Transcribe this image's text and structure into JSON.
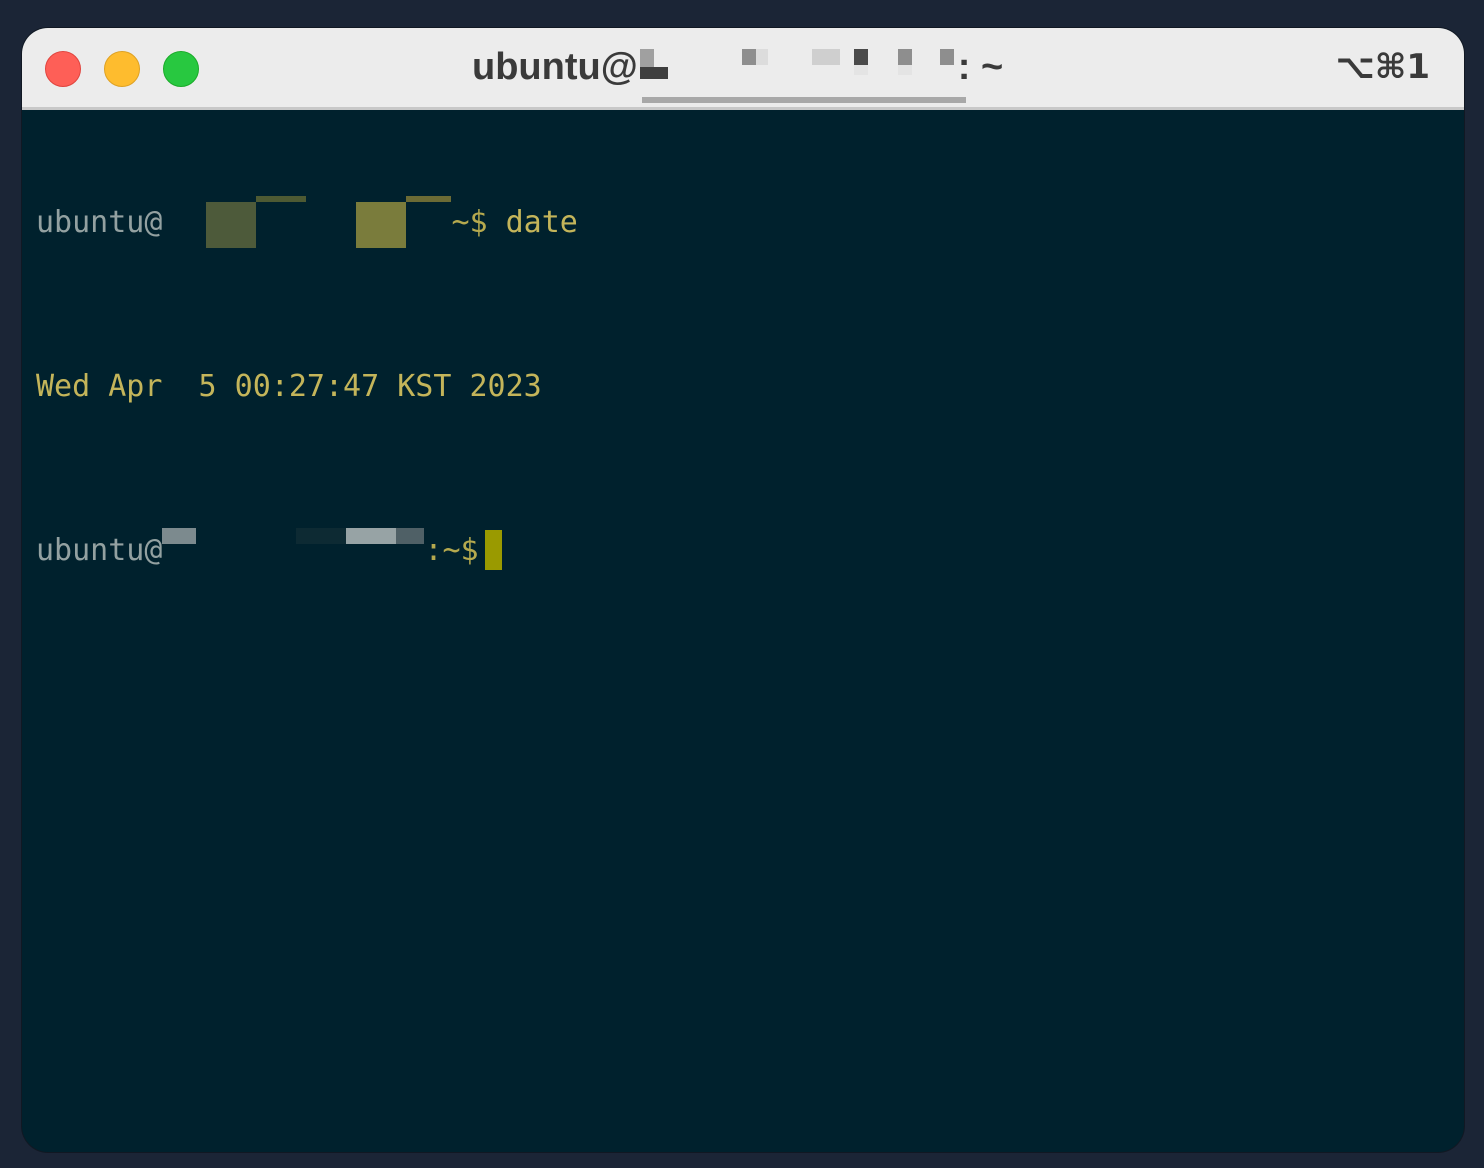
{
  "window": {
    "title_prefix": "ubuntu@",
    "title_suffix": ": ~",
    "shortcut": "⌥⌘1"
  },
  "terminal": {
    "line1": {
      "user": "ubuntu@",
      "tail": "~$ ",
      "command": "date"
    },
    "line2": {
      "output": "Wed Apr  5 00:27:47 KST 2023"
    },
    "line3": {
      "user": "ubuntu@",
      "tail": ":~$"
    }
  },
  "colors": {
    "background": "#00212d",
    "titlebar": "#ececec",
    "prompt_user": "#93a1a1",
    "prompt_text": "#c4b55a",
    "cursor": "#9a9a00"
  }
}
